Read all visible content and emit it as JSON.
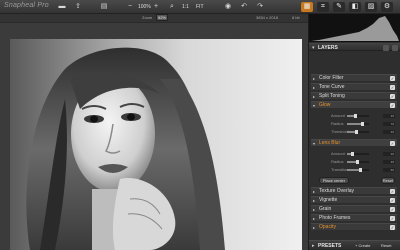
{
  "app": {
    "brand": "Snapheal Pro"
  },
  "toolbar": {
    "zoom_value": "100%",
    "reset_label": "1:1",
    "fit_label": "FIT"
  },
  "infobar": {
    "zoom_label": "Zoom",
    "zoom_value": "92%",
    "dimensions": "3654 x 2018",
    "bit_depth": "8 bit"
  },
  "panel": {
    "layers_title": "LAYERS",
    "layers": [
      {
        "name": "Color Filter",
        "checked": "✓"
      },
      {
        "name": "Tone Curve",
        "checked": "✓"
      },
      {
        "name": "Split Toning",
        "checked": "✓"
      },
      {
        "name": "Glow",
        "checked": "✓",
        "active": true
      }
    ],
    "glow_params": [
      {
        "label": "Amount",
        "value": "35"
      },
      {
        "label": "Radius",
        "value": "70"
      },
      {
        "label": "Threshold",
        "value": "40"
      }
    ],
    "lens_blur": {
      "name": "Lens Blur",
      "checked": "✓"
    },
    "lens_params": [
      {
        "label": "Amount",
        "value": "20"
      },
      {
        "label": "Radius",
        "value": "45"
      },
      {
        "label": "Transition",
        "value": "60"
      }
    ],
    "place_center_label": "Place center",
    "reset_label": "Reset",
    "layers_bottom": [
      {
        "name": "Texture Overlay",
        "checked": "✓"
      },
      {
        "name": "Vignette",
        "checked": "✓"
      },
      {
        "name": "Grain",
        "checked": "✓"
      },
      {
        "name": "Photo Frames",
        "checked": "✓"
      },
      {
        "name": "Opacity",
        "checked": "✓"
      }
    ],
    "presets_title": "PRESETS",
    "create_label": "+ Create",
    "reset_presets_label": "Reset"
  }
}
